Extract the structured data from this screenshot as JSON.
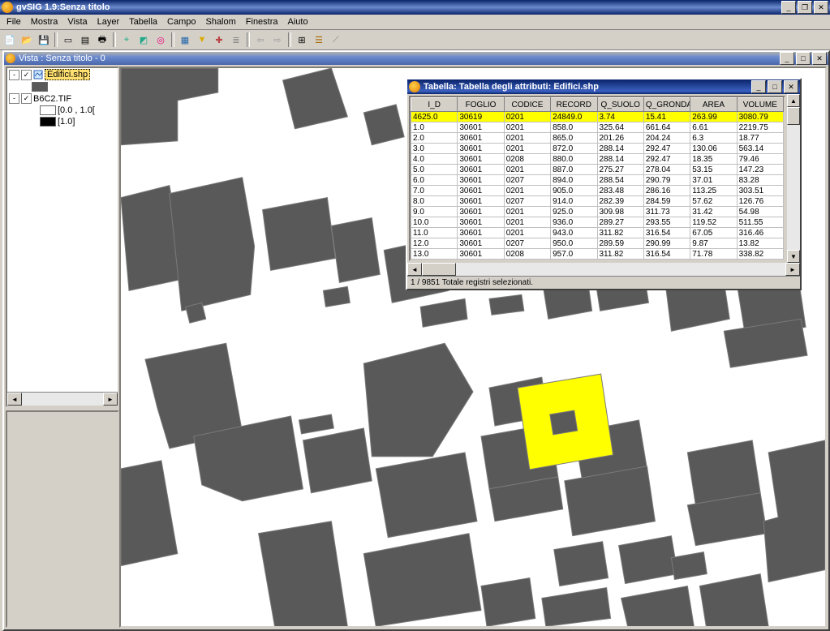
{
  "app": {
    "title": "gvSIG 1.9:Senza titolo",
    "menus": [
      "File",
      "Mostra",
      "Vista",
      "Layer",
      "Tabella",
      "Campo",
      "Shalom",
      "Finestra",
      "Aiuto"
    ],
    "toolbar_icons": [
      "new-icon",
      "open-icon",
      "save-icon",
      "divider",
      "layout-icon",
      "document-icon",
      "print-icon",
      "divider",
      "zoom-area-icon",
      "zoom-layer-icon",
      "locator-icon",
      "divider",
      "table-icon",
      "filter-icon",
      "chart-icon",
      "layers-icon",
      "divider",
      "prev-icon",
      "next-icon",
      "divider",
      "grid-icon",
      "select-icon",
      "measure-icon"
    ]
  },
  "view": {
    "title": "Vista : Senza titolo - 0",
    "layers": {
      "edifici": {
        "name": "Edifici.shp",
        "checked": true,
        "fill": "#595959"
      },
      "raster": {
        "name": "B6C2.TIF",
        "checked": true,
        "classes": [
          {
            "label": "[0.0 , 1.0[",
            "fill": "#ffffff"
          },
          {
            "label": "[1.0]",
            "fill": "#000000"
          }
        ]
      }
    }
  },
  "table": {
    "title": "Tabella: Tabella degli attributi: Edifici.shp",
    "status": "1 / 9851 Totale registri selezionati.",
    "columns": [
      "I_D",
      "FOGLIO",
      "CODICE",
      "RECORD",
      "Q_SUOLO",
      "Q_GRONDA",
      "AREA",
      "VOLUME"
    ],
    "selected_index": 0,
    "rows": [
      [
        "4625.0",
        "30619",
        "0201",
        "24849.0",
        "3.74",
        "15.41",
        "263.99",
        "3080.79"
      ],
      [
        "1.0",
        "30601",
        "0201",
        "858.0",
        "325.64",
        "661.64",
        "6.61",
        "2219.75"
      ],
      [
        "2.0",
        "30601",
        "0201",
        "865.0",
        "201.26",
        "204.24",
        "6.3",
        "18.77"
      ],
      [
        "3.0",
        "30601",
        "0201",
        "872.0",
        "288.14",
        "292.47",
        "130.06",
        "563.14"
      ],
      [
        "4.0",
        "30601",
        "0208",
        "880.0",
        "288.14",
        "292.47",
        "18.35",
        "79.46"
      ],
      [
        "5.0",
        "30601",
        "0201",
        "887.0",
        "275.27",
        "278.04",
        "53.15",
        "147.23"
      ],
      [
        "6.0",
        "30601",
        "0207",
        "894.0",
        "288.54",
        "290.79",
        "37.01",
        "83.28"
      ],
      [
        "7.0",
        "30601",
        "0201",
        "905.0",
        "283.48",
        "286.16",
        "113.25",
        "303.51"
      ],
      [
        "8.0",
        "30601",
        "0207",
        "914.0",
        "282.39",
        "284.59",
        "57.62",
        "126.76"
      ],
      [
        "9.0",
        "30601",
        "0201",
        "925.0",
        "309.98",
        "311.73",
        "31.42",
        "54.98"
      ],
      [
        "10.0",
        "30601",
        "0201",
        "936.0",
        "289.27",
        "293.55",
        "119.52",
        "511.55"
      ],
      [
        "11.0",
        "30601",
        "0201",
        "943.0",
        "311.82",
        "316.54",
        "67.05",
        "316.46"
      ],
      [
        "12.0",
        "30601",
        "0207",
        "950.0",
        "289.59",
        "290.99",
        "9.87",
        "13.82"
      ],
      [
        "13.0",
        "30601",
        "0208",
        "957.0",
        "311.82",
        "316.54",
        "71.78",
        "338.82"
      ]
    ]
  },
  "chart_data": {
    "type": "table",
    "title": "Tabella degli attributi: Edifici.shp",
    "columns": [
      "I_D",
      "FOGLIO",
      "CODICE",
      "RECORD",
      "Q_SUOLO",
      "Q_GRONDA",
      "AREA",
      "VOLUME"
    ],
    "rows": [
      [
        4625.0,
        30619,
        "0201",
        24849.0,
        3.74,
        15.41,
        263.99,
        3080.79
      ],
      [
        1.0,
        30601,
        "0201",
        858.0,
        325.64,
        661.64,
        6.61,
        2219.75
      ],
      [
        2.0,
        30601,
        "0201",
        865.0,
        201.26,
        204.24,
        6.3,
        18.77
      ],
      [
        3.0,
        30601,
        "0201",
        872.0,
        288.14,
        292.47,
        130.06,
        563.14
      ],
      [
        4.0,
        30601,
        "0208",
        880.0,
        288.14,
        292.47,
        18.35,
        79.46
      ],
      [
        5.0,
        30601,
        "0201",
        887.0,
        275.27,
        278.04,
        53.15,
        147.23
      ],
      [
        6.0,
        30601,
        "0207",
        894.0,
        288.54,
        290.79,
        37.01,
        83.28
      ],
      [
        7.0,
        30601,
        "0201",
        905.0,
        283.48,
        286.16,
        113.25,
        303.51
      ],
      [
        8.0,
        30601,
        "0207",
        914.0,
        282.39,
        284.59,
        57.62,
        126.76
      ],
      [
        9.0,
        30601,
        "0201",
        925.0,
        309.98,
        311.73,
        31.42,
        54.98
      ],
      [
        10.0,
        30601,
        "0201",
        936.0,
        289.27,
        293.55,
        119.52,
        511.55
      ],
      [
        11.0,
        30601,
        "0201",
        943.0,
        311.82,
        316.54,
        67.05,
        316.46
      ],
      [
        12.0,
        30601,
        "0207",
        950.0,
        289.59,
        290.99,
        9.87,
        13.82
      ],
      [
        13.0,
        30601,
        "0208",
        957.0,
        311.82,
        316.54,
        71.78,
        338.82
      ]
    ]
  }
}
